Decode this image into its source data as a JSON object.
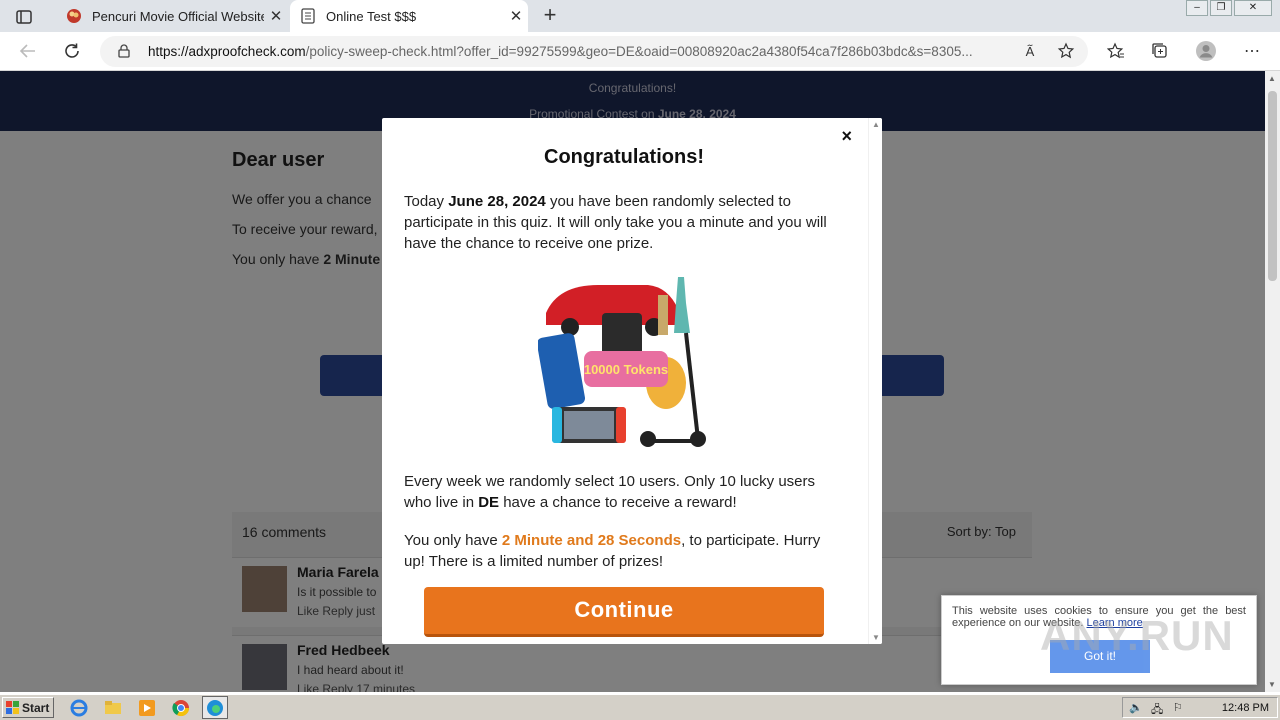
{
  "browser": {
    "tabs": [
      {
        "title": "Pencuri Movie Official Website",
        "active": false,
        "icon": "popcorn-icon"
      },
      {
        "title": "Online Test $$$",
        "active": true,
        "icon": "page-icon"
      }
    ],
    "url_domain": "https://adxproofcheck.com",
    "url_path": "/policy-sweep-check.html?offer_id=99275599&geo=DE&oaid=00808920ac2a4380f54ca7f286b03bdc&s=8305..."
  },
  "page": {
    "banner_line1": "Congratulations!",
    "banner_line2_prefix": "Promotional Contest on ",
    "banner_line2_date": "June 28, 2024",
    "greeting": "Dear user",
    "line1": "We offer you a chance",
    "line2": "To receive your reward,",
    "line3_prefix": "You only have ",
    "line3_bold": "2 Minute",
    "comments_count": "16 comments",
    "sort_label": "Sort by:",
    "sort_value": "Top",
    "comments": [
      {
        "name": "Maria Farela",
        "text": "Is it possible to",
        "actions": "Like Reply  just"
      },
      {
        "name": "Fred Hedbeek",
        "text": "I had heard about it!",
        "actions": "Like Reply  17 minutes"
      }
    ]
  },
  "modal": {
    "close": "×",
    "title": "Congratulations!",
    "p1_a": "Today ",
    "p1_date": "June 28, 2024",
    "p1_b": " you have been randomly selected to participate in this quiz. It will only take you a minute and you will have the chance to receive one prize.",
    "prize_text": "10000 Tokens",
    "p2_a": "Every week we randomly select 10 users. Only 10 lucky users who live in ",
    "p2_geo": "DE",
    "p2_b": " have a chance to receive a reward!",
    "p3_a": "You only have ",
    "p3_time": "2 Minute and 28 Seconds",
    "p3_b": ", to participate. Hurry up! There is a limited number of prizes!",
    "button": "Continue"
  },
  "cookie": {
    "message": "This website uses cookies to ensure you get the best experience on our website.",
    "link": "Learn more",
    "button": "Got it!"
  },
  "watermark": "ANY.RUN",
  "taskbar": {
    "start": "Start",
    "clock": "12:48 PM"
  },
  "colors": {
    "banner": "#1e2d57",
    "accent_orange": "#e8741d",
    "cookie_button": "#4a86e8"
  }
}
